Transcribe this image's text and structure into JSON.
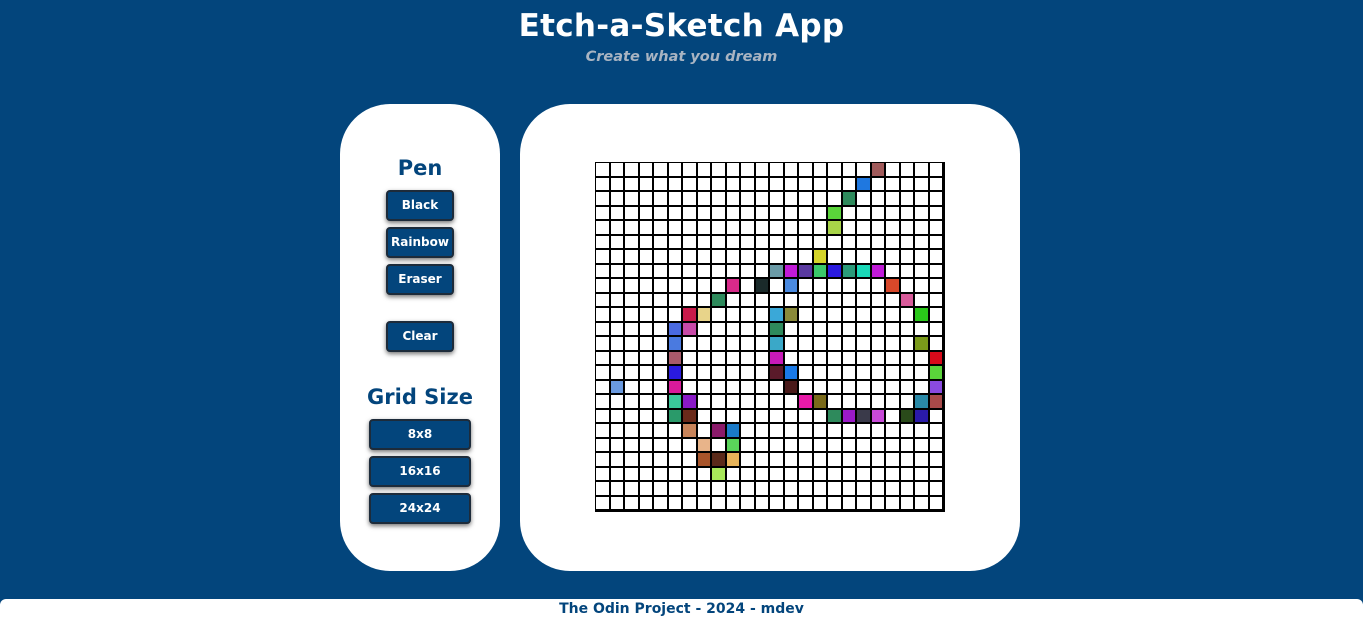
{
  "header": {
    "title": "Etch-a-Sketch App",
    "subtitle": "Create what you dream"
  },
  "controls": {
    "pen_title": "Pen",
    "pen_buttons": [
      "Black",
      "Rainbow",
      "Eraser"
    ],
    "clear_label": "Clear",
    "grid_title": "Grid Size",
    "grid_buttons": [
      "8x8",
      "16x16",
      "24x24"
    ]
  },
  "footer": {
    "text": "The Odin Project - 2024 - mdev"
  },
  "colors": {
    "brand": "#03457c",
    "panel": "#ffffff",
    "grid_line": "#000000"
  },
  "canvas": {
    "grid_size": 24,
    "painted_cells": [
      {
        "row": 0,
        "col": 19,
        "color": "#a05a5a"
      },
      {
        "row": 1,
        "col": 18,
        "color": "#1f78e0"
      },
      {
        "row": 2,
        "col": 17,
        "color": "#2e8a5c"
      },
      {
        "row": 3,
        "col": 16,
        "color": "#5ad43a"
      },
      {
        "row": 4,
        "col": 16,
        "color": "#a8d448"
      },
      {
        "row": 6,
        "col": 15,
        "color": "#d4d42a"
      },
      {
        "row": 7,
        "col": 12,
        "color": "#6a9aa6"
      },
      {
        "row": 7,
        "col": 13,
        "color": "#c01ad8"
      },
      {
        "row": 7,
        "col": 14,
        "color": "#5a3aa0"
      },
      {
        "row": 7,
        "col": 15,
        "color": "#3ac86a"
      },
      {
        "row": 7,
        "col": 16,
        "color": "#2a1ae0"
      },
      {
        "row": 7,
        "col": 17,
        "color": "#2a9a7a"
      },
      {
        "row": 7,
        "col": 18,
        "color": "#1ad8b8"
      },
      {
        "row": 7,
        "col": 19,
        "color": "#c01ad8"
      },
      {
        "row": 8,
        "col": 9,
        "color": "#d82a8a"
      },
      {
        "row": 8,
        "col": 11,
        "color": "#1a2a2a"
      },
      {
        "row": 8,
        "col": 13,
        "color": "#4a8ae0"
      },
      {
        "row": 8,
        "col": 20,
        "color": "#d8482a"
      },
      {
        "row": 9,
        "col": 8,
        "color": "#2e8a5c"
      },
      {
        "row": 9,
        "col": 21,
        "color": "#d85a9a"
      },
      {
        "row": 10,
        "col": 6,
        "color": "#c81a4a"
      },
      {
        "row": 10,
        "col": 7,
        "color": "#e8d48a"
      },
      {
        "row": 10,
        "col": 12,
        "color": "#3aa8d8"
      },
      {
        "row": 10,
        "col": 13,
        "color": "#8a8a3a"
      },
      {
        "row": 10,
        "col": 22,
        "color": "#2ac81a"
      },
      {
        "row": 11,
        "col": 5,
        "color": "#4a6ae0"
      },
      {
        "row": 11,
        "col": 6,
        "color": "#c84aa8"
      },
      {
        "row": 11,
        "col": 12,
        "color": "#2e8a5c"
      },
      {
        "row": 12,
        "col": 5,
        "color": "#4a7ae0"
      },
      {
        "row": 12,
        "col": 12,
        "color": "#3aa8c8"
      },
      {
        "row": 12,
        "col": 22,
        "color": "#7a9a1a"
      },
      {
        "row": 13,
        "col": 5,
        "color": "#a85a6a"
      },
      {
        "row": 13,
        "col": 12,
        "color": "#c81ab8"
      },
      {
        "row": 13,
        "col": 23,
        "color": "#d80a1a"
      },
      {
        "row": 14,
        "col": 5,
        "color": "#2a1ae0"
      },
      {
        "row": 14,
        "col": 12,
        "color": "#5a1a2a"
      },
      {
        "row": 14,
        "col": 13,
        "color": "#1a7ae8"
      },
      {
        "row": 14,
        "col": 23,
        "color": "#5ad43a"
      },
      {
        "row": 15,
        "col": 1,
        "color": "#6a9ae0"
      },
      {
        "row": 15,
        "col": 5,
        "color": "#d81a9a"
      },
      {
        "row": 15,
        "col": 13,
        "color": "#4a1a1a"
      },
      {
        "row": 15,
        "col": 23,
        "color": "#8a4ae0"
      },
      {
        "row": 16,
        "col": 5,
        "color": "#3ac89a"
      },
      {
        "row": 16,
        "col": 6,
        "color": "#8a1ac8"
      },
      {
        "row": 16,
        "col": 14,
        "color": "#e81aa8"
      },
      {
        "row": 16,
        "col": 15,
        "color": "#7a6a1a"
      },
      {
        "row": 16,
        "col": 22,
        "color": "#2a8aa8"
      },
      {
        "row": 16,
        "col": 23,
        "color": "#a84a4a"
      },
      {
        "row": 17,
        "col": 5,
        "color": "#2a9a6a"
      },
      {
        "row": 17,
        "col": 6,
        "color": "#6a2a1a"
      },
      {
        "row": 17,
        "col": 16,
        "color": "#2e8a5c"
      },
      {
        "row": 17,
        "col": 17,
        "color": "#9a1ac8"
      },
      {
        "row": 17,
        "col": 18,
        "color": "#3a3a4a"
      },
      {
        "row": 17,
        "col": 19,
        "color": "#c84ad8"
      },
      {
        "row": 17,
        "col": 21,
        "color": "#2a4a1a"
      },
      {
        "row": 17,
        "col": 22,
        "color": "#2a1aa8"
      },
      {
        "row": 18,
        "col": 6,
        "color": "#c8845a"
      },
      {
        "row": 18,
        "col": 8,
        "color": "#8a1a6a"
      },
      {
        "row": 18,
        "col": 9,
        "color": "#1a7ac8"
      },
      {
        "row": 19,
        "col": 7,
        "color": "#e8b48a"
      },
      {
        "row": 19,
        "col": 9,
        "color": "#5ad45a"
      },
      {
        "row": 20,
        "col": 7,
        "color": "#a8542a"
      },
      {
        "row": 20,
        "col": 8,
        "color": "#5a2a1a"
      },
      {
        "row": 20,
        "col": 9,
        "color": "#e8b45a"
      },
      {
        "row": 21,
        "col": 8,
        "color": "#a8e85a"
      }
    ]
  }
}
